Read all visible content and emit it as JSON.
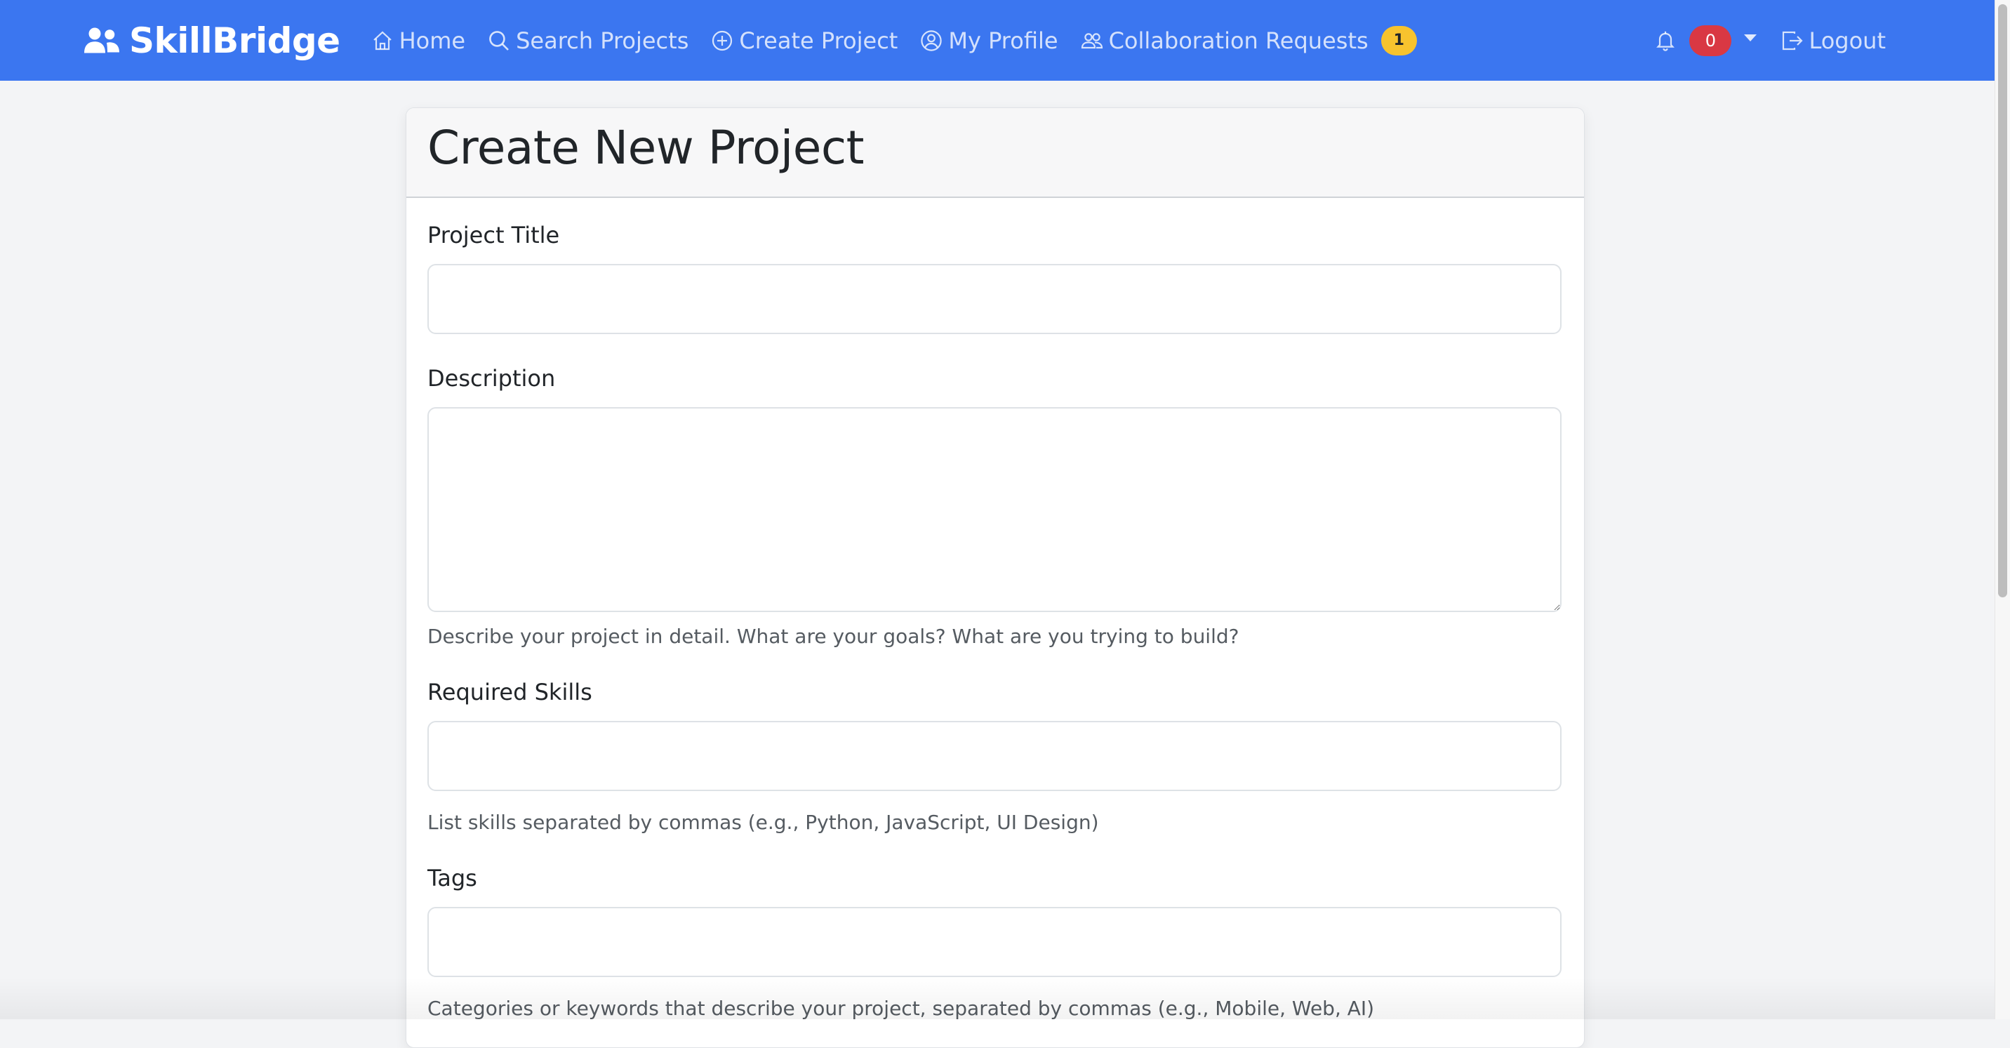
{
  "navbar": {
    "brand": "SkillBridge",
    "brand_icon": "people-icon",
    "links": [
      {
        "label": "Home",
        "icon": "house-icon"
      },
      {
        "label": "Search Projects",
        "icon": "search-icon"
      },
      {
        "label": "Create Project",
        "icon": "plus-circle-icon"
      },
      {
        "label": "My Profile",
        "icon": "person-circle-icon"
      },
      {
        "label": "Collaboration Requests",
        "icon": "people-outline-icon"
      }
    ],
    "collab_badge": "1",
    "notification_count": "0",
    "logout_label": "Logout"
  },
  "page": {
    "title": "Create New Project"
  },
  "form": {
    "title_label": "Project Title",
    "title_value": "",
    "description_label": "Description",
    "description_value": "",
    "description_help": "Describe your project in detail. What are your goals? What are you trying to build?",
    "skills_label": "Required Skills",
    "skills_value": "",
    "skills_help": "List skills separated by commas (e.g., Python, JavaScript, UI Design)",
    "tags_label": "Tags",
    "tags_value": "",
    "tags_help": "Categories or keywords that describe your project, separated by commas (e.g., Mobile, Web, AI)"
  },
  "colors": {
    "navbar": "#3b76f0",
    "warning_badge": "#f7c32e",
    "danger_badge": "#d93843",
    "page_bg": "#f3f4f6"
  }
}
